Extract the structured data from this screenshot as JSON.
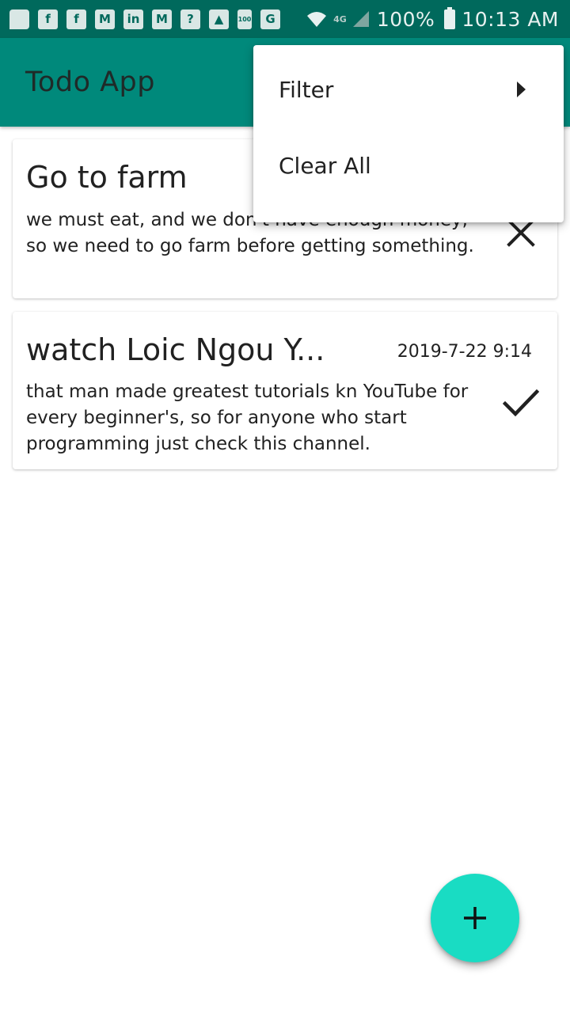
{
  "status_bar": {
    "notification_icons": [
      "chat-icon",
      "facebook-icon",
      "facebook-icon",
      "gmail-icon",
      "linkedin-icon",
      "inbox-icon",
      "help-icon",
      "image-icon",
      "battery-100-icon",
      "translate-icon"
    ],
    "network": "4G",
    "battery_percent": "100%",
    "time": "10:13 AM"
  },
  "app_bar": {
    "title": "Todo App"
  },
  "menu": {
    "items": [
      {
        "label": "Filter",
        "has_submenu": true
      },
      {
        "label": "Clear All",
        "has_submenu": false
      }
    ]
  },
  "todos": [
    {
      "title": "Go to farm",
      "description": "we must eat, and we don't have enough money,  so we need to go farm before getting something.",
      "action_icon": "close-icon"
    },
    {
      "title": "watch Loic Ngou Y...",
      "date": "2019-7-22 9:14",
      "description": "that man made greatest tutorials kn YouTube for every beginner's, so for anyone who start programming just check this channel.",
      "action_icon": "check-icon"
    }
  ],
  "fab": {
    "icon": "add-icon"
  },
  "colors": {
    "status_bar": "#00695c",
    "app_bar": "#00897b",
    "fab": "#19dcc3"
  }
}
